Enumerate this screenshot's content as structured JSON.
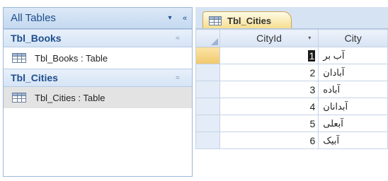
{
  "nav": {
    "title": "All Tables",
    "dropdown_icon": "▾",
    "collapse_icon": "«",
    "groups": [
      {
        "title": "Tbl_Books",
        "collapse_icon": "≈",
        "item_label": "Tbl_Books : Table"
      },
      {
        "title": "Tbl_Cities",
        "collapse_icon": "≈",
        "item_label": "Tbl_Cities : Table"
      }
    ]
  },
  "doc": {
    "tab_label": "Tbl_Cities",
    "columns": [
      "CityId",
      "City"
    ],
    "sort_icon": "▾",
    "rows": [
      {
        "id": "1",
        "city": "آب بر"
      },
      {
        "id": "2",
        "city": "آبادان"
      },
      {
        "id": "3",
        "city": "آباده"
      },
      {
        "id": "4",
        "city": "آبدانان"
      },
      {
        "id": "5",
        "city": "آبعلی"
      },
      {
        "id": "6",
        "city": "آبیک"
      }
    ]
  },
  "colors": {
    "accent": "#1e4e8c",
    "tab": "#f5dd8c",
    "current_row": "#f2c86a"
  }
}
